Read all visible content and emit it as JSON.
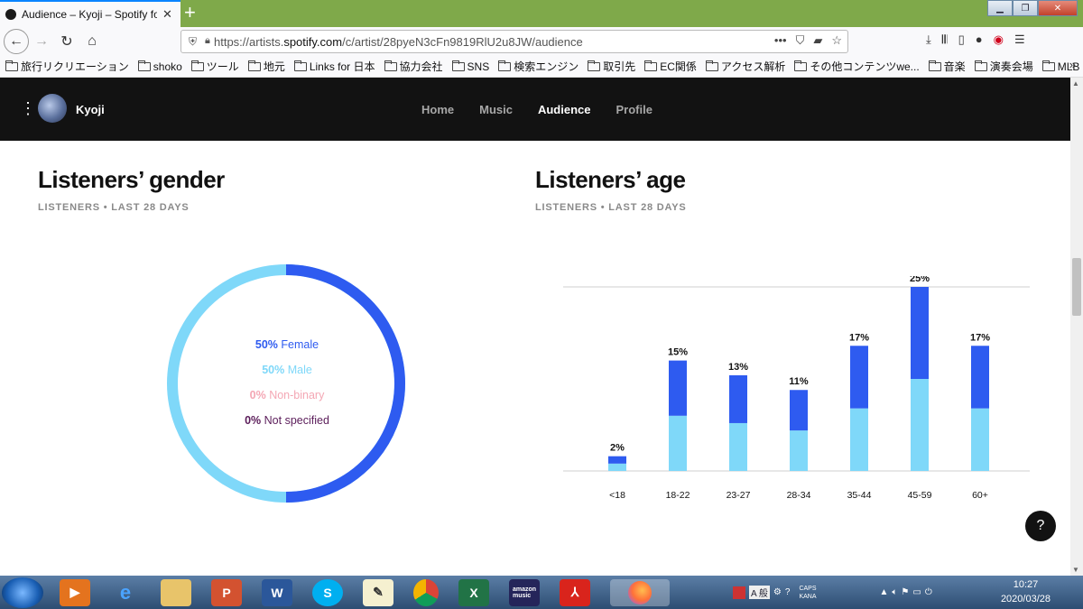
{
  "browser": {
    "tab_title": "Audience – Kyoji – Spotify for Artists",
    "url_prefix": "https://artists.",
    "url_domain": "spotify.com",
    "url_path": "/c/artist/28pyeN3cFn9819RlU2u8JW/audience"
  },
  "bookmarks": [
    "旅行リクリエーション",
    "shoko",
    "ツール",
    "地元",
    "Links for 日本",
    "協力会社",
    "SNS",
    "検索エンジン",
    "取引先",
    "EC関係",
    "アクセス解析",
    "その他コンテンツwe...",
    "音楽",
    "演奏会場",
    "MLB"
  ],
  "header": {
    "artist_name": "Kyoji",
    "nav": [
      {
        "label": "Home",
        "active": false
      },
      {
        "label": "Music",
        "active": false
      },
      {
        "label": "Audience",
        "active": true
      },
      {
        "label": "Profile",
        "active": false
      }
    ]
  },
  "gender": {
    "title": "Listeners’ gender",
    "subtitle": "LISTENERS • LAST 28 DAYS",
    "items": [
      {
        "value": "50%",
        "label": "Female",
        "color": "#2e5bf0"
      },
      {
        "value": "50%",
        "label": "Male",
        "color": "#7fd8f9"
      },
      {
        "value": "0%",
        "label": "Non-binary",
        "color": "#f4a7b4"
      },
      {
        "value": "0%",
        "label": "Not specified",
        "color": "#5b1d5a"
      }
    ]
  },
  "age": {
    "title": "Listeners’ age",
    "subtitle": "LISTENERS • LAST 28 DAYS"
  },
  "chart_data": {
    "type": "bar",
    "stacked": true,
    "categories": [
      "<18",
      "18-22",
      "23-27",
      "28-34",
      "35-44",
      "45-59",
      "60+"
    ],
    "totals_label": [
      "2%",
      "15%",
      "13%",
      "11%",
      "17%",
      "25%",
      "17%"
    ],
    "series": [
      {
        "color": "#2e5bf0",
        "values": [
          1,
          7.5,
          6.5,
          5.5,
          8.5,
          12.5,
          8.5
        ]
      },
      {
        "color": "#7fd8f9",
        "values": [
          1,
          7.5,
          6.5,
          5.5,
          8.5,
          12.5,
          8.5
        ]
      }
    ],
    "ylim": [
      0,
      25
    ],
    "grid": true
  },
  "taskbar": {
    "clock_time": "10:27",
    "clock_date": "2020/03/28",
    "apps": [
      "ie",
      "explorer",
      "powerpoint",
      "word",
      "skype",
      "notepad",
      "chrome",
      "excel",
      "amazon music",
      "acrobat",
      "firefox"
    ]
  }
}
